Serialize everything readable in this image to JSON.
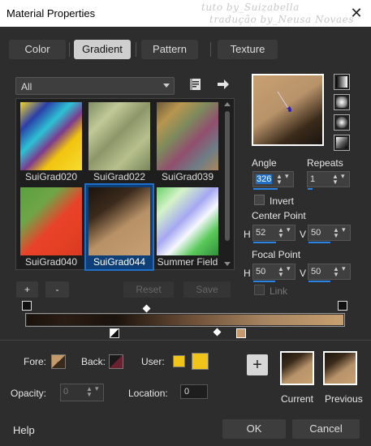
{
  "window": {
    "title": "Material Properties",
    "watermark_line1": "tuto by_Suizabella",
    "watermark_line2": "tradução by_Neusa Novaes",
    "close_glyph": "✕"
  },
  "tabs": [
    {
      "label": "Color",
      "active": false
    },
    {
      "label": "Gradient",
      "active": true
    },
    {
      "label": "Pattern",
      "active": false
    },
    {
      "label": "Texture",
      "active": false
    }
  ],
  "category": {
    "selected": "All"
  },
  "gallery": {
    "items": [
      {
        "label": "SuiGrad020"
      },
      {
        "label": "SuiGrad022"
      },
      {
        "label": "SuiGrad039"
      },
      {
        "label": "SuiGrad040"
      },
      {
        "label": "SuiGrad044",
        "selected": true
      },
      {
        "label": "Summer Field"
      }
    ]
  },
  "gallery_buttons": {
    "add": "+",
    "remove": "-",
    "reset": "Reset",
    "save": "Save"
  },
  "angle": {
    "label": "Angle",
    "value": "326"
  },
  "repeats": {
    "label": "Repeats",
    "value": "1"
  },
  "invert": {
    "label": "Invert"
  },
  "center_point": {
    "label": "Center Point",
    "h_label": "H",
    "h_value": "52",
    "v_label": "V",
    "v_value": "50"
  },
  "focal_point": {
    "label": "Focal Point",
    "h_label": "H",
    "h_value": "50",
    "v_label": "V",
    "v_value": "50"
  },
  "link": {
    "label": "Link"
  },
  "materials": {
    "fore_label": "Fore:",
    "back_label": "Back:",
    "user_label": "User:",
    "opacity_label": "Opacity:",
    "opacity_value": "0",
    "location_label": "Location:",
    "location_value": "0"
  },
  "preview": {
    "current_label": "Current",
    "previous_label": "Previous",
    "add_glyph": "+"
  },
  "footer": {
    "help": "Help",
    "ok": "OK",
    "cancel": "Cancel"
  },
  "colors": {
    "accent": "#1f6fc9",
    "user_swatch": "#f0c419",
    "bg": "#2d2d2d"
  }
}
